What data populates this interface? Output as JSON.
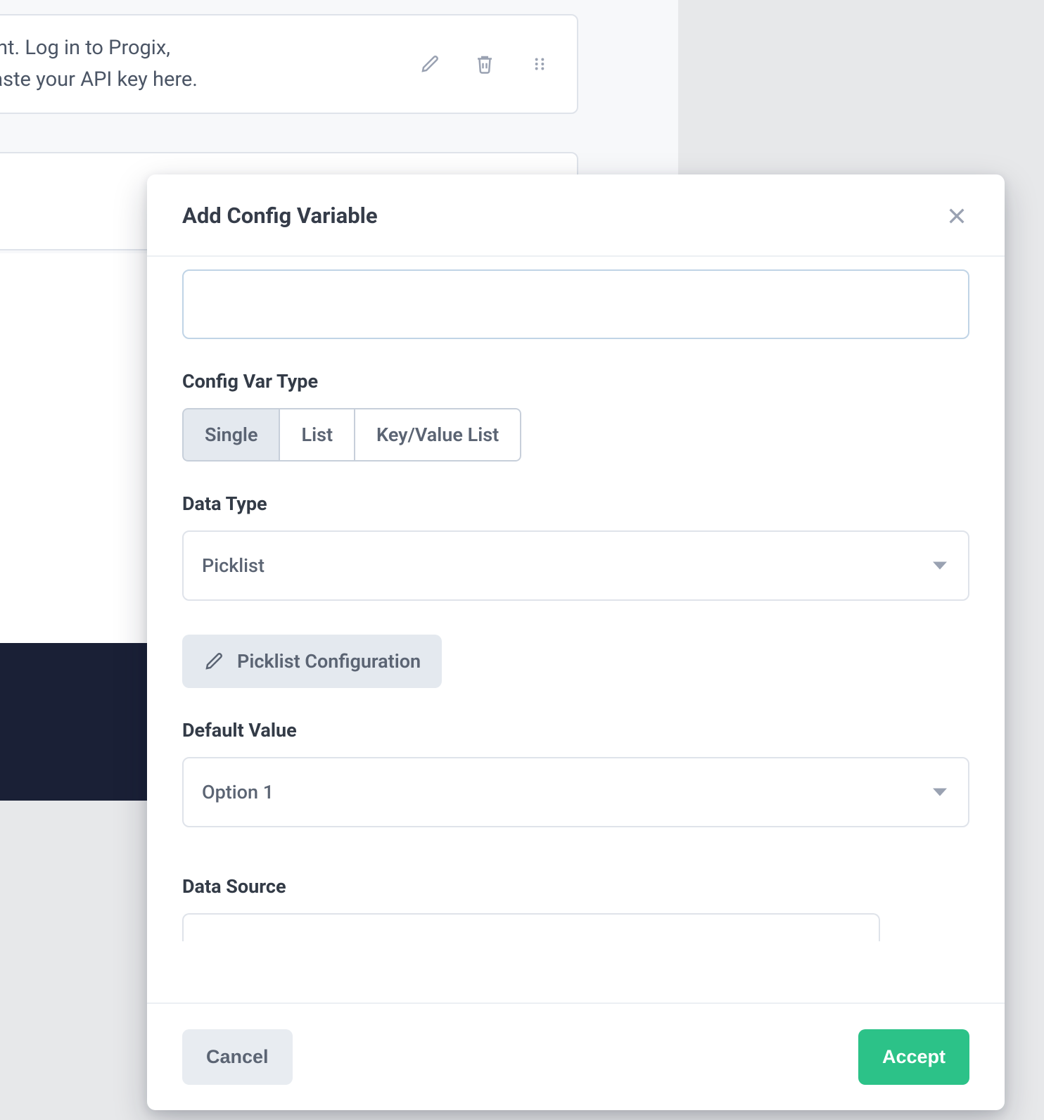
{
  "background": {
    "card_text": "r Progix account. Log in to Progix,\nate API Key. Paste your API key here."
  },
  "modal": {
    "title": "Add Config Variable",
    "name_value": "",
    "config_var_type": {
      "label": "Config Var Type",
      "options": [
        "Single",
        "List",
        "Key/Value List"
      ],
      "selected": "Single"
    },
    "data_type": {
      "label": "Data Type",
      "value": "Picklist"
    },
    "picklist_button": "Picklist Configuration",
    "default_value": {
      "label": "Default Value",
      "value": "Option 1"
    },
    "data_source": {
      "label": "Data Source"
    },
    "footer": {
      "cancel": "Cancel",
      "accept": "Accept"
    }
  },
  "colors": {
    "accent_green": "#2cc288",
    "muted_bg": "#e4e9ef",
    "border": "#dfe3ea",
    "focus_border": "#c0d4e6",
    "text_primary": "#333b47",
    "text_muted": "#5b6473",
    "dark_strip": "#1a2036"
  }
}
